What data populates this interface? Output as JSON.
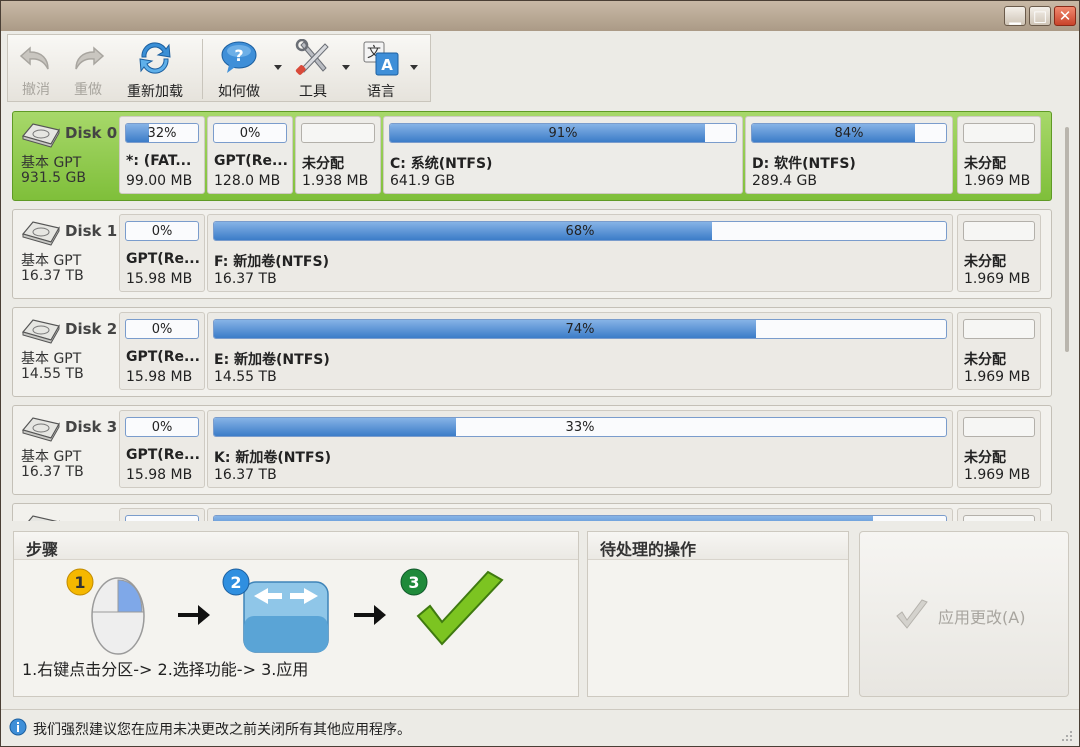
{
  "toolbar": {
    "undo": "撤消",
    "redo": "重做",
    "reload": "重新加载",
    "howto": "如何做",
    "tools": "工具",
    "language": "语言",
    "lang_icon_top": "文",
    "lang_icon_bottom": "A",
    "help_icon_glyph": "?"
  },
  "disks": [
    {
      "name": "Disk 0",
      "type": "基本 GPT",
      "size": "931.5 GB",
      "partitions": [
        {
          "name": "*: (FAT...",
          "size": "99.00 MB",
          "usage": "32%",
          "fill": 0.32
        },
        {
          "name": "GPT(Re...",
          "size": "128.0 MB",
          "usage": "0%",
          "fill": 0.0
        },
        {
          "name": "未分配",
          "size": "1.938 MB",
          "usage": "",
          "fill": 0.0
        },
        {
          "name": "C: 系统(NTFS)",
          "size": "641.9 GB",
          "usage": "91%",
          "fill": 0.91
        },
        {
          "name": "D: 软件(NTFS)",
          "size": "289.4 GB",
          "usage": "84%",
          "fill": 0.84
        },
        {
          "name": "未分配",
          "size": "1.969 MB",
          "usage": "",
          "fill": 0.0
        }
      ]
    },
    {
      "name": "Disk 1",
      "type": "基本 GPT",
      "size": "16.37 TB",
      "partitions": [
        {
          "name": "GPT(Re...",
          "size": "15.98 MB",
          "usage": "0%",
          "fill": 0.0
        },
        {
          "name": "F: 新加卷(NTFS)",
          "size": "16.37 TB",
          "usage": "68%",
          "fill": 0.68
        },
        {
          "name": "未分配",
          "size": "1.969 MB",
          "usage": "",
          "fill": 0.0
        }
      ]
    },
    {
      "name": "Disk 2",
      "type": "基本 GPT",
      "size": "14.55 TB",
      "partitions": [
        {
          "name": "GPT(Re...",
          "size": "15.98 MB",
          "usage": "0%",
          "fill": 0.0
        },
        {
          "name": "E: 新加卷(NTFS)",
          "size": "14.55 TB",
          "usage": "74%",
          "fill": 0.74
        },
        {
          "name": "未分配",
          "size": "1.969 MB",
          "usage": "",
          "fill": 0.0
        }
      ]
    },
    {
      "name": "Disk 3",
      "type": "基本 GPT",
      "size": "16.37 TB",
      "partitions": [
        {
          "name": "GPT(Re...",
          "size": "15.98 MB",
          "usage": "0%",
          "fill": 0.0
        },
        {
          "name": "K: 新加卷(NTFS)",
          "size": "16.37 TB",
          "usage": "33%",
          "fill": 0.33
        },
        {
          "name": "未分配",
          "size": "1.969 MB",
          "usage": "",
          "fill": 0.0
        }
      ]
    },
    {
      "name": "",
      "type": "",
      "size": "",
      "partitions": [
        {
          "name": "",
          "size": "",
          "usage": "",
          "fill": 0.0
        },
        {
          "name": "",
          "size": "",
          "usage": "",
          "fill": 0.9
        },
        {
          "name": "",
          "size": "",
          "usage": "",
          "fill": 0.0
        }
      ]
    }
  ],
  "steps_panel": {
    "title": "步骤",
    "step1": "1",
    "step2": "2",
    "step3": "3",
    "instruction": "1.右键点击分区-> 2.选择功能-> 3.应用"
  },
  "pending_panel": {
    "title": "待处理的操作"
  },
  "apply": {
    "label": "应用更改(A)"
  },
  "status": {
    "text": "我们强烈建议您在应用未决更改之前关闭所有其他应用程序。"
  },
  "colors": {
    "selected_row": "#8fcb4a",
    "usage_bar": "#4a86cf",
    "title_bar": "#b9a893",
    "close_button": "#d9553a"
  }
}
